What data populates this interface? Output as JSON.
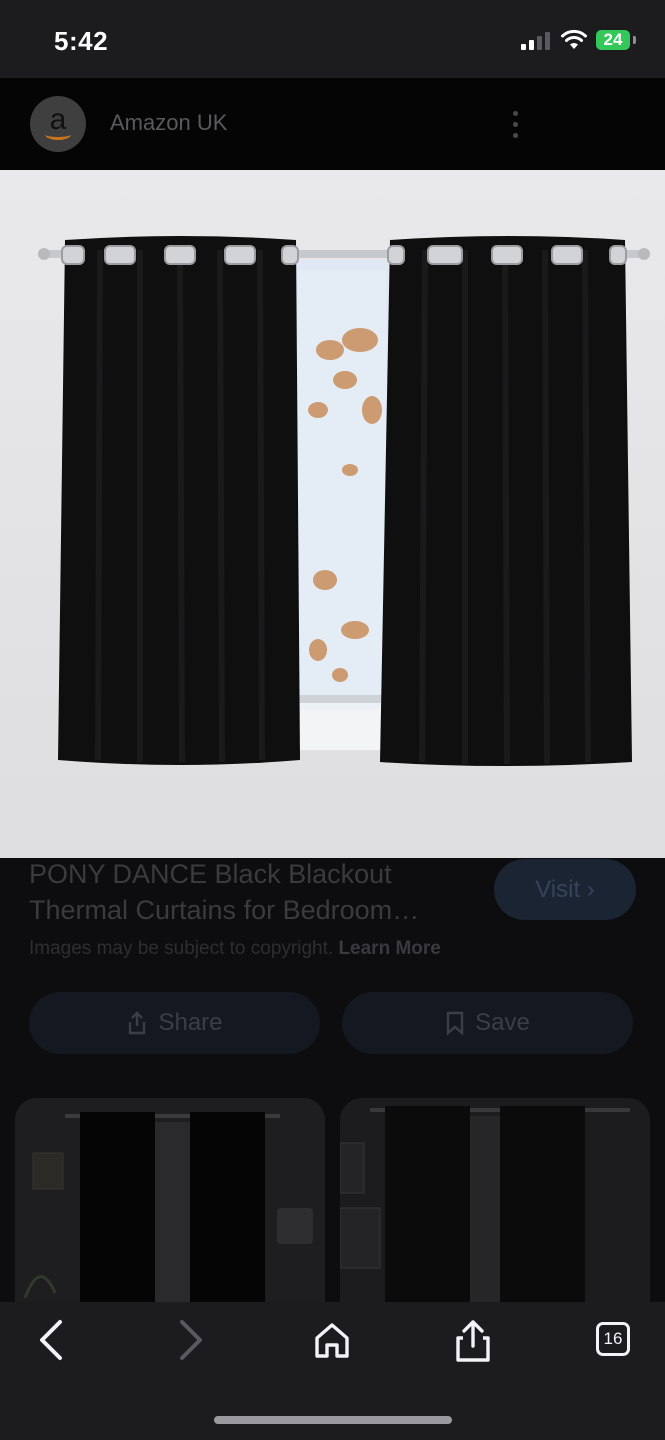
{
  "status_bar": {
    "time": "5:42",
    "battery": "24"
  },
  "header": {
    "logo_letter": "a",
    "site_name": "Amazon UK"
  },
  "product": {
    "title": "PONY DANCE Black Blackout Thermal Curtains for Bedroom…",
    "visit_label": "Visit",
    "copyright_text": "Images may be subject to copyright.",
    "learn_more": "Learn More",
    "share_label": "Share",
    "save_label": "Save"
  },
  "toolbar": {
    "tabs_count": "16"
  },
  "colors": {
    "battery": "#34c759",
    "visit_button_bg": "#1b2433",
    "curtain": "#0f0f10"
  }
}
